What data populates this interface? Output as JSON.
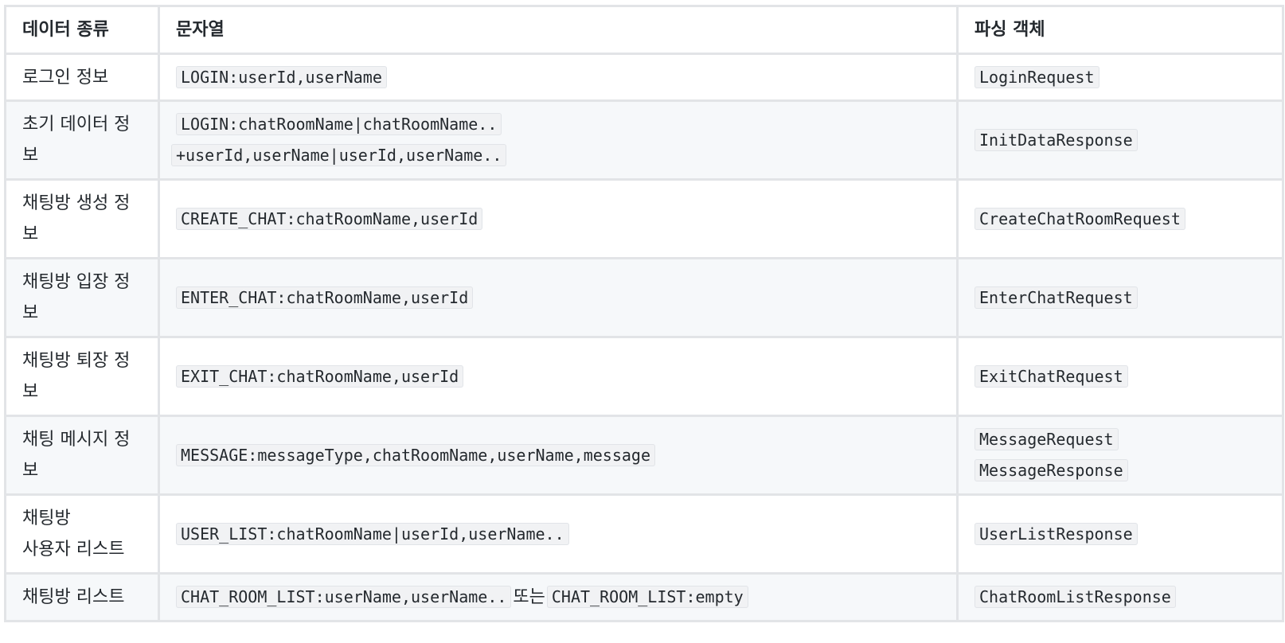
{
  "headers": [
    "데이터 종류",
    "문자열",
    "파싱 객체"
  ],
  "rows": [
    {
      "type": "로그인 정보",
      "string": [
        "LOGIN:userId,userName"
      ],
      "objects": [
        "LoginRequest"
      ]
    },
    {
      "type": "초기 데이터 정보",
      "string": [
        "LOGIN:chatRoomName|chatRoomName..",
        "+userId,userName|userId,userName.."
      ],
      "objects": [
        "InitDataResponse"
      ]
    },
    {
      "type": "채팅방 생성 정보",
      "string": [
        "CREATE_CHAT:chatRoomName,userId"
      ],
      "objects": [
        "CreateChatRoomRequest"
      ]
    },
    {
      "type": "채팅방 입장 정보",
      "string": [
        "ENTER_CHAT:chatRoomName,userId"
      ],
      "objects": [
        "EnterChatRequest"
      ]
    },
    {
      "type": "채팅방 퇴장 정보",
      "string": [
        "EXIT_CHAT:chatRoomName,userId"
      ],
      "objects": [
        "ExitChatRequest"
      ]
    },
    {
      "type": "채팅 메시지 정보",
      "string": [
        "MESSAGE:messageType,chatRoomName,userName,message"
      ],
      "objects": [
        "MessageRequest",
        "MessageResponse"
      ]
    },
    {
      "type_lines": [
        "채팅방",
        "사용자 리스트"
      ],
      "string": [
        "USER_LIST:chatRoomName|userId,userName.."
      ],
      "objects": [
        "UserListResponse"
      ]
    },
    {
      "type": "채팅방 리스트",
      "string_a": "CHAT_ROOM_LIST:userName,userName..",
      "string_sep": "또는",
      "string_b": "CHAT_ROOM_LIST:empty",
      "objects": [
        "ChatRoomListResponse"
      ]
    }
  ]
}
